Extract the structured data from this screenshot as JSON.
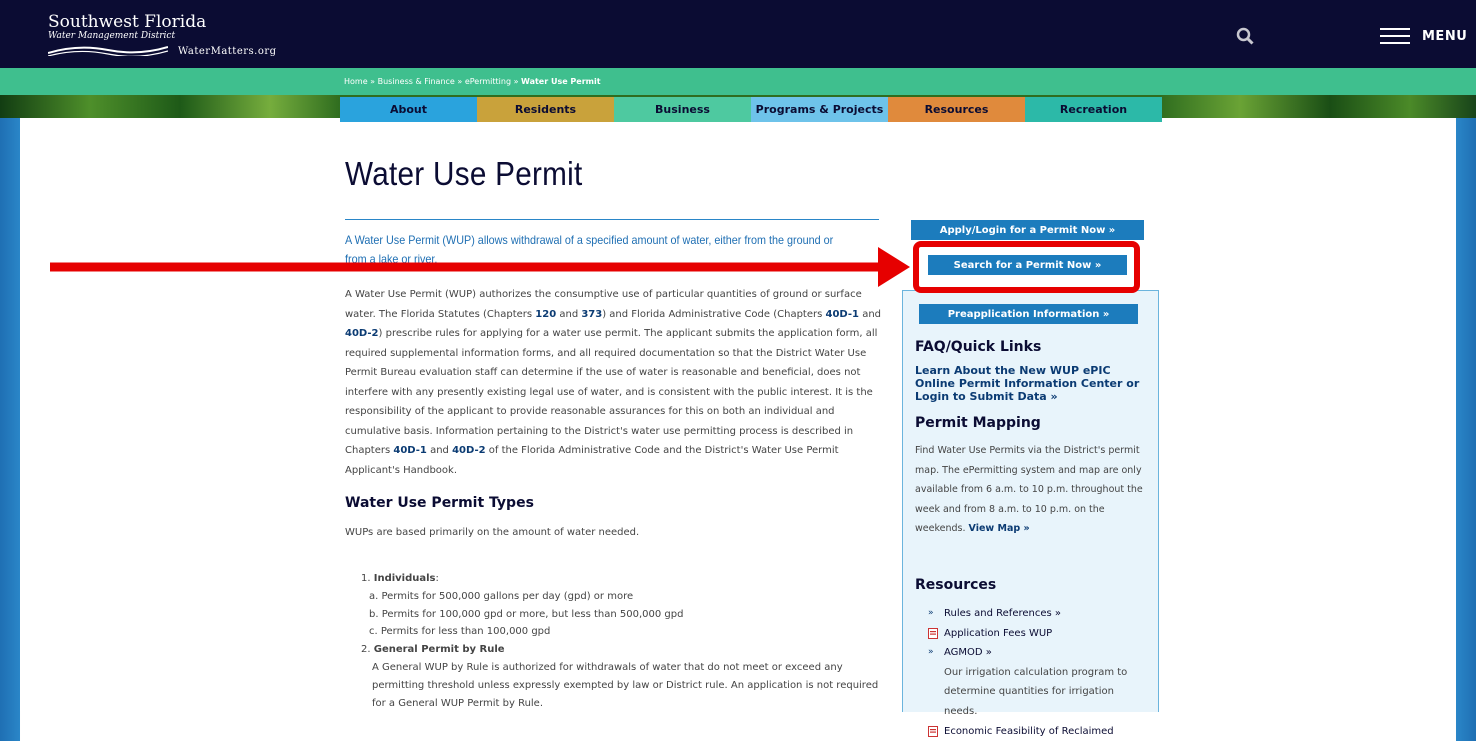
{
  "header": {
    "logo_line1": "Southwest Florida",
    "logo_line2": "Water Management District",
    "logo_site": "WaterMatters.org",
    "menu_label": "MENU"
  },
  "breadcrumb": {
    "items": [
      "Home",
      "Business & Finance",
      "ePermitting"
    ],
    "current": "Water Use Permit",
    "separator": "»"
  },
  "nav_tabs": [
    {
      "label": "About",
      "color": "#2aa3dd"
    },
    {
      "label": "Residents",
      "color": "#c9a23b"
    },
    {
      "label": "Business",
      "color": "#4ec9a0"
    },
    {
      "label": "Programs & Projects",
      "color": "#6ec3ea"
    },
    {
      "label": "Resources",
      "color": "#e08a3c"
    },
    {
      "label": "Recreation",
      "color": "#2cb9a8"
    }
  ],
  "page": {
    "title": "Water Use Permit",
    "intro": "A Water Use Permit (WUP) allows withdrawal of a specified amount of water, either from the ground or from a lake or river.",
    "body_parts": [
      "A Water Use Permit (WUP) authorizes the consumptive use of particular quantities of ground or surface water. The Florida Statutes (Chapters ",
      "120",
      " and ",
      "373",
      ") and Florida Administrative Code (Chapters ",
      "40D-1",
      " and ",
      "40D-2",
      ") prescribe rules for applying for a water use permit. The applicant submits the application form, all required supplemental information forms, and all required documentation so that the District Water Use Permit Bureau evaluation staff can determine if the use of water is reasonable and beneficial, does not interfere with any presently existing legal use of water, and is consistent with the public interest. It is the responsibility of the applicant to provide reasonable assurances for this on both an individual and cumulative basis. Information pertaining to the District's water use permitting process is described in Chapters ",
      "40D-1",
      " and ",
      "40D-2",
      " of the Florida Administrative Code and the District's Water Use Permit Applicant's Handbook."
    ],
    "types_heading": "Water Use Permit Types",
    "types_intro": "WUPs are based primarily on the amount of water needed.",
    "types": {
      "item1_label": "Individuals",
      "item1_sub": [
        "a. Permits for 500,000 gallons per day (gpd) or more",
        "b. Permits for 100,000 gpd or more, but less than 500,000 gpd",
        "c. Permits for less than 100,000 gpd"
      ],
      "item2_label": "General Permit by Rule",
      "item2_text": "A General WUP by Rule is authorized for withdrawals of water that do not meet or exceed any permitting threshold unless expressly exempted by law or District rule. An application is not required for a General WUP Permit by Rule."
    }
  },
  "sidebar": {
    "apply_button": "Apply/Login for a Permit Now »",
    "search_button": "Search for a Permit Now »",
    "preapp_button": "Preapplication Information »",
    "faq_heading": "FAQ/Quick Links",
    "faq_link": "Learn About the New WUP ePIC Online Permit Information Center or Login to Submit Data »",
    "mapping_heading": "Permit Mapping",
    "mapping_text": "Find Water Use Permits via the District's permit map. The ePermitting system and map are only available from 6 a.m. to 10 p.m. throughout the week and from 8 a.m. to 10 p.m. on the weekends. ",
    "mapping_link": "View Map »",
    "resources_heading": "Resources",
    "resources": {
      "rules": "Rules and References »",
      "fees": "Application Fees WUP",
      "agmod": "AGMOD »",
      "agmod_desc": "Our irrigation calculation program to determine quantities for irrigation needs.",
      "econ": "Economic Feasibility of Reclaimed"
    }
  },
  "annotation": {
    "color": "#e60000"
  }
}
